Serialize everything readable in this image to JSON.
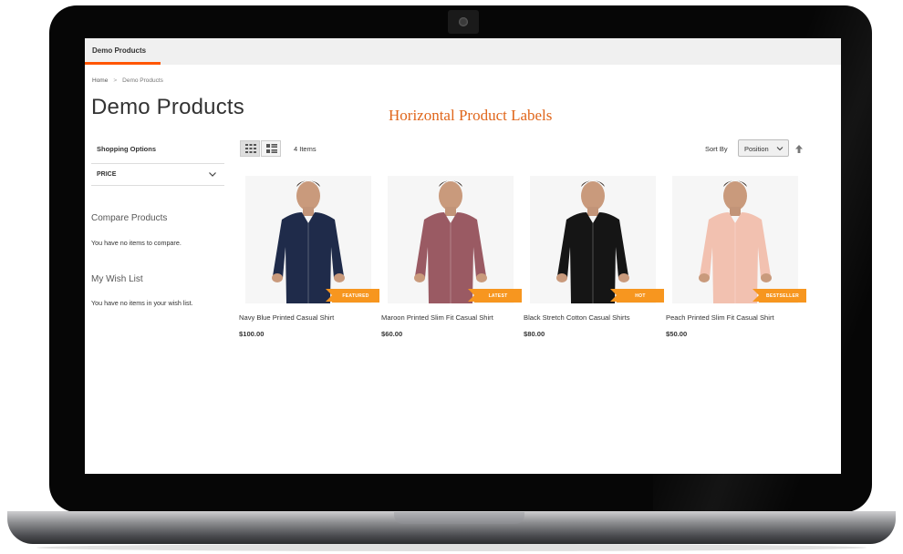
{
  "nav": {
    "active_item": "Demo Products"
  },
  "breadcrumb": {
    "home": "Home",
    "separator": ">",
    "current": "Demo Products"
  },
  "page": {
    "title": "Demo Products",
    "banner": "Horizontal Product Labels"
  },
  "sidebar": {
    "shopping_options": "Shopping Options",
    "filter_label": "PRICE",
    "compare_title": "Compare Products",
    "compare_text": "You have no items to compare.",
    "wishlist_title": "My Wish List",
    "wishlist_text": "You have no items in your wish list."
  },
  "toolbar": {
    "item_count": "4 Items",
    "sort_label": "Sort By",
    "sort_value": "Position",
    "grid_icon": "grid-view-icon",
    "list_icon": "list-view-icon",
    "sort_direction_icon": "arrow-up-icon"
  },
  "products": [
    {
      "name": "Navy Blue Printed Casual Shirt",
      "price": "$100.00",
      "label": "FEATURED",
      "shirt_color": "#1f2b4a"
    },
    {
      "name": "Maroon Printed Slim Fit Casual Shirt",
      "price": "$60.00",
      "label": "LATEST",
      "shirt_color": "#9a5a63"
    },
    {
      "name": "Black Stretch Cotton Casual Shirts",
      "price": "$80.00",
      "label": "HOT",
      "shirt_color": "#151515"
    },
    {
      "name": "Peach Printed Slim Fit Casual Shirt",
      "price": "$50.00",
      "label": "BESTSELLER",
      "shirt_color": "#f2c1b0"
    }
  ],
  "colors": {
    "accent": "#ff5501",
    "label_bg": "#f7961f",
    "banner_text": "#e0661b"
  }
}
